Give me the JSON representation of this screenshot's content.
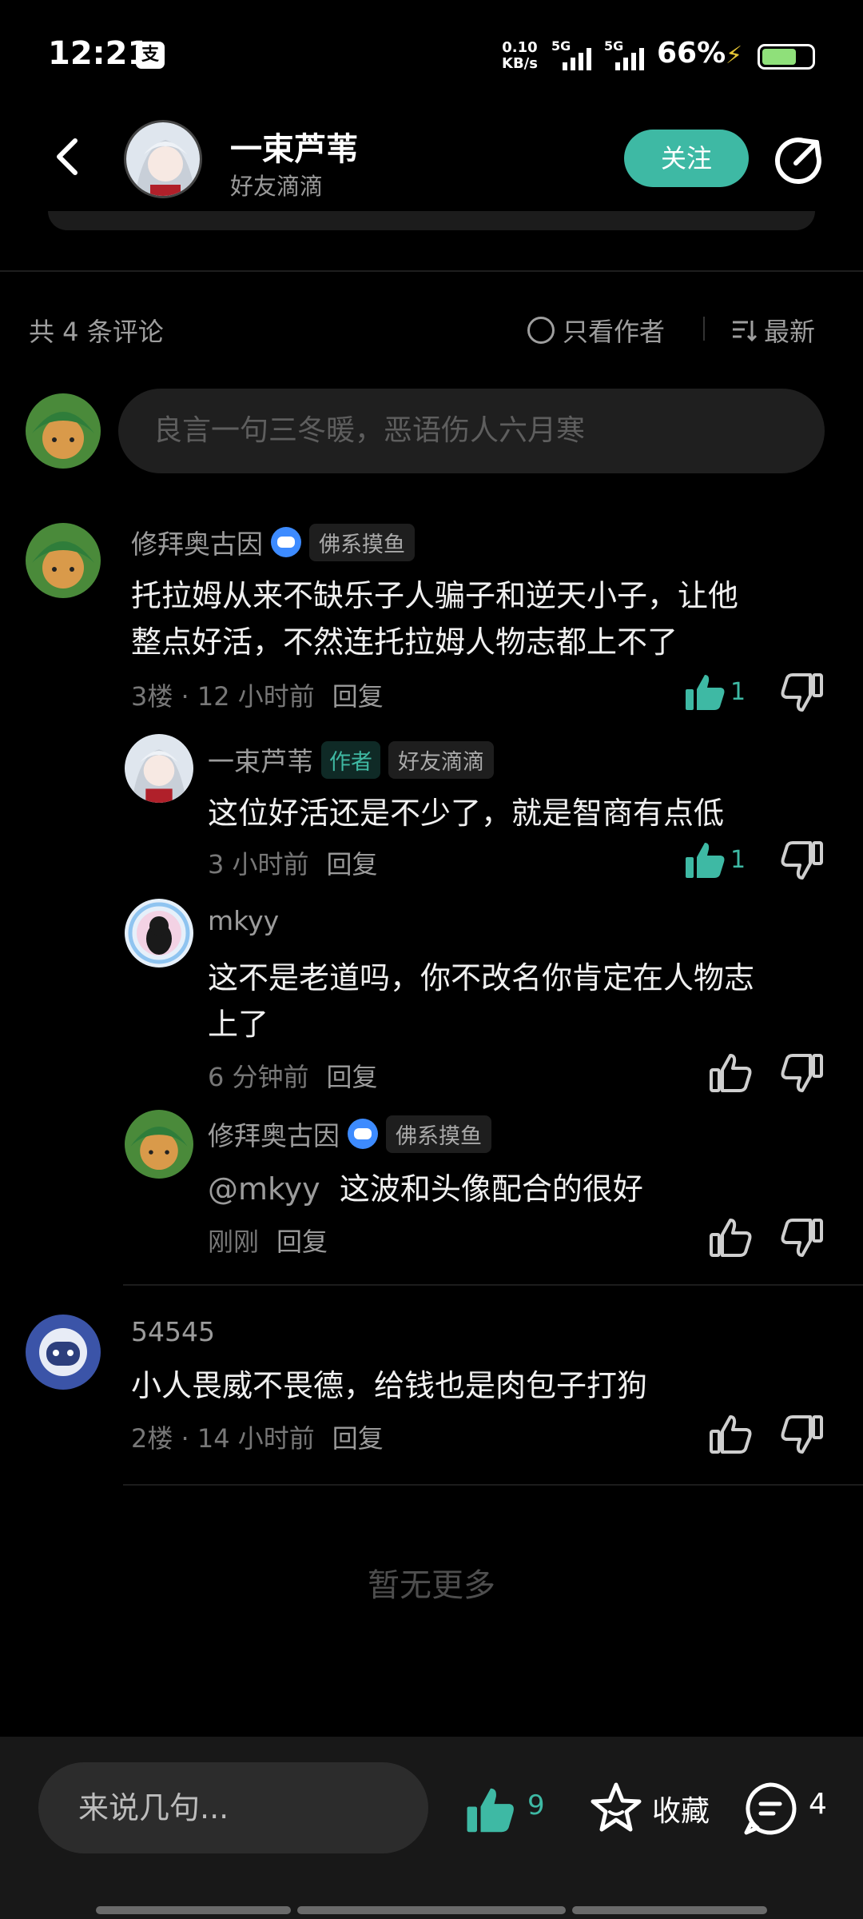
{
  "status_bar": {
    "time": "12:21",
    "app_icon_text": "支",
    "net_speed_value": "0.10",
    "net_speed_unit": "KB/s",
    "sim1": "5G",
    "sim2": "5G",
    "battery": "66%",
    "battery_color": "#8fe07a"
  },
  "header": {
    "author_name": "一束芦苇",
    "author_badge": "好友滴滴",
    "follow_label": "关注",
    "accent_color": "#3eb9a4"
  },
  "comments_bar": {
    "count_text": "共 4 条评论",
    "only_author_label": "只看作者",
    "sort_label": "最新"
  },
  "composer": {
    "placeholder": "良言一句三冬暖，恶语伤人六月寒"
  },
  "comments": [
    {
      "user": "修拜奥古因",
      "badge": "佛系摸鱼",
      "text_line1": "托拉姆从来不缺乐子人骗子和逆天小子，让他",
      "text_line2": "整点好活，不然连托拉姆人物志都上不了",
      "floor": "3楼",
      "time": "12 小时前",
      "reply_label": "回复",
      "likes": "1",
      "replies": [
        {
          "user": "一束芦苇",
          "author_tag": "作者",
          "badge": "好友滴滴",
          "text": "这位好活还是不少了，就是智商有点低",
          "time": "3 小时前",
          "reply_label": "回复",
          "likes": "1"
        },
        {
          "user": "mkyy",
          "text_line1": "这不是老道吗，你不改名你肯定在人物志",
          "text_line2": "上了",
          "time": "6 分钟前",
          "reply_label": "回复"
        },
        {
          "user": "修拜奥古因",
          "badge": "佛系摸鱼",
          "mention": "@mkyy",
          "text": "这波和头像配合的很好",
          "time": "刚刚",
          "reply_label": "回复"
        }
      ]
    },
    {
      "user": "54545",
      "text": "小人畏威不畏德，给钱也是肉包子打狗",
      "floor": "2楼",
      "time": "14 小时前",
      "reply_label": "回复"
    }
  ],
  "no_more": "暂无更多",
  "bottom_bar": {
    "input_placeholder": "来说几句...",
    "like_count": "9",
    "fav_label": "收藏",
    "comment_count": "4"
  }
}
